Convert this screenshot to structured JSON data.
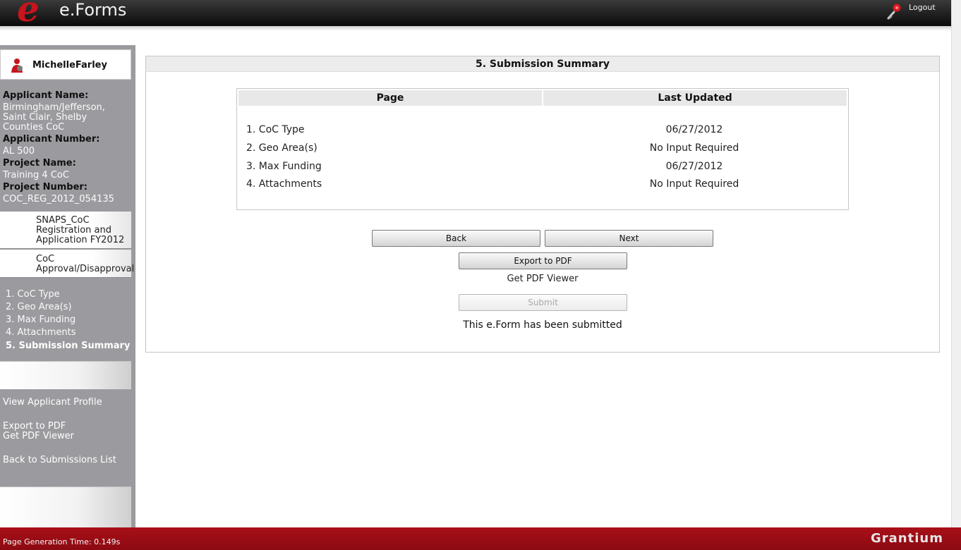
{
  "header": {
    "logo_letter": "e",
    "logo_text": "e.Forms",
    "logout_label": "Logout"
  },
  "sidebar": {
    "user_name": "MichelleFarley",
    "applicant_name_label": "Applicant Name:",
    "applicant_name_lines": [
      "Birmingham/Jefferson,",
      "Saint Clair, Shelby",
      "Counties CoC"
    ],
    "applicant_number_label": "Applicant Number:",
    "applicant_number": "AL 500",
    "project_name_label": "Project Name:",
    "project_name": "Training 4 CoC",
    "project_number_label": "Project Number:",
    "project_number": "COC_REG_2012_054135",
    "nav_blocks": [
      {
        "lines": [
          "SNAPS_CoC",
          "Registration and",
          "Application FY2012"
        ]
      },
      {
        "lines": [
          "CoC",
          "Approval/Disapproval"
        ]
      }
    ],
    "steps": [
      {
        "label": "1. CoC Type"
      },
      {
        "label": "2. Geo Area(s)"
      },
      {
        "label": "3. Max Funding"
      },
      {
        "label": "4. Attachments"
      },
      {
        "label": "5. Submission Summary"
      }
    ],
    "links": {
      "view_profile": "View Applicant Profile",
      "export_pdf": "Export to PDF",
      "get_pdf_viewer": "Get PDF Viewer",
      "back_to_list": "Back to Submissions List"
    }
  },
  "main": {
    "title": "5. Submission Summary",
    "table": {
      "col_page": "Page",
      "col_updated": "Last Updated",
      "rows": [
        {
          "page": "1. CoC Type",
          "updated": "06/27/2012"
        },
        {
          "page": "2. Geo Area(s)",
          "updated": "No Input Required"
        },
        {
          "page": "3. Max Funding",
          "updated": "06/27/2012"
        },
        {
          "page": "4. Attachments",
          "updated": "No Input Required"
        }
      ]
    },
    "buttons": {
      "back": "Back",
      "next": "Next",
      "export_pdf": "Export to PDF",
      "submit": "Submit"
    },
    "get_pdf_viewer": "Get PDF Viewer",
    "submitted_message": "This e.Form has been submitted"
  },
  "footer": {
    "generation_time": "Page Generation Time: 0.149s",
    "brand": "Grantium"
  },
  "colors": {
    "brand_red": "#c8141c",
    "footer_red": "#a80f18",
    "sidebar_gray": "#9b9b9f"
  }
}
